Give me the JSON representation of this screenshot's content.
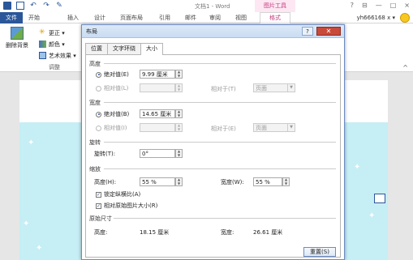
{
  "window": {
    "doc_title": "文档1 - Word",
    "picture_tools": "图片工具",
    "controls": [
      "?",
      "⊟",
      "—",
      "□",
      "×"
    ]
  },
  "ribbon_tabs": {
    "file": "文件",
    "items": [
      "开始",
      "插入",
      "设计",
      "页面布局",
      "引用",
      "邮件",
      "审阅",
      "视图"
    ],
    "format": "格式",
    "user": "yh666168 x ▾"
  },
  "ribbon": {
    "remove_bg": "删除背景",
    "correct": "更正 ▾",
    "color": "颜色 ▾",
    "art_effects": "艺术效果 ▾",
    "group_label": "调整",
    "collapse": "^"
  },
  "dialog": {
    "title": "布局",
    "help": "?",
    "close": "✕",
    "tabs": [
      "位置",
      "文字环绕",
      "大小"
    ],
    "height": {
      "section": "高度",
      "absolute_label": "绝对值(E)",
      "absolute_value": "9.99 厘米",
      "relative_label": "相对值(L)",
      "relative_to_label": "相对于(T)",
      "relative_to_value": "页面"
    },
    "width": {
      "section": "宽度",
      "absolute_label": "绝对值(B)",
      "absolute_value": "14.65 厘米",
      "relative_label": "相对值(I)",
      "relative_to_label": "相对于(E)",
      "relative_to_value": "页面"
    },
    "rotate": {
      "section": "旋转",
      "label": "旋转(T):",
      "value": "0°"
    },
    "scale": {
      "section": "缩放",
      "height_label": "高度(H):",
      "height_value": "55 %",
      "width_label": "宽度(W):",
      "width_value": "55 %",
      "lock_ratio": "锁定纵横比(A)",
      "relative_orig": "相对原始图片大小(R)"
    },
    "original": {
      "section": "原始尺寸",
      "height_label": "高度:",
      "height_value": "18.15 厘米",
      "width_label": "宽度:",
      "width_value": "26.61 厘米"
    },
    "reset": "重置(S)"
  }
}
